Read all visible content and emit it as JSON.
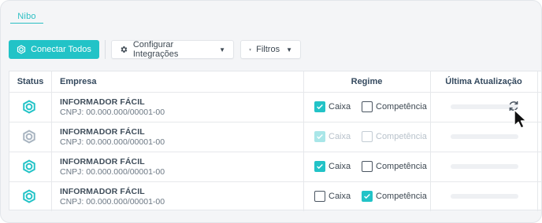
{
  "tabs": [
    {
      "label": "Nibo"
    }
  ],
  "toolbar": {
    "connect_all_label": "Conectar Todos",
    "config_label": "Configurar Integrações",
    "filter_label": "Filtros"
  },
  "table": {
    "headers": {
      "status": "Status",
      "company": "Empresa",
      "regime": "Regime",
      "last_update": "Última Atualização"
    },
    "regime_options": [
      "Caixa",
      "Competência"
    ],
    "rows": [
      {
        "name": "INFORMADOR FÁCIL",
        "cnpj": "CNPJ: 00.000.000/00001-00",
        "status": "connected",
        "caixa": true,
        "competencia": false,
        "disabled": false,
        "refresh_icon": "refresh-icon"
      },
      {
        "name": "INFORMADOR FÁCIL",
        "cnpj": "CNPJ: 00.000.000/00001-00",
        "status": "disconnected",
        "caixa": true,
        "competencia": false,
        "disabled": true
      },
      {
        "name": "INFORMADOR FÁCIL",
        "cnpj": "CNPJ: 00.000.000/00001-00",
        "status": "connected",
        "caixa": true,
        "competencia": false,
        "disabled": false
      },
      {
        "name": "INFORMADOR FÁCIL",
        "cnpj": "CNPJ: 00.000.000/00001-00",
        "status": "connected",
        "caixa": false,
        "competencia": true,
        "disabled": false
      }
    ]
  },
  "colors": {
    "accent": "#22c3c7",
    "status_connected": "#22c3c7",
    "status_disconnected": "#a8b4c0",
    "text": "#34495e"
  }
}
